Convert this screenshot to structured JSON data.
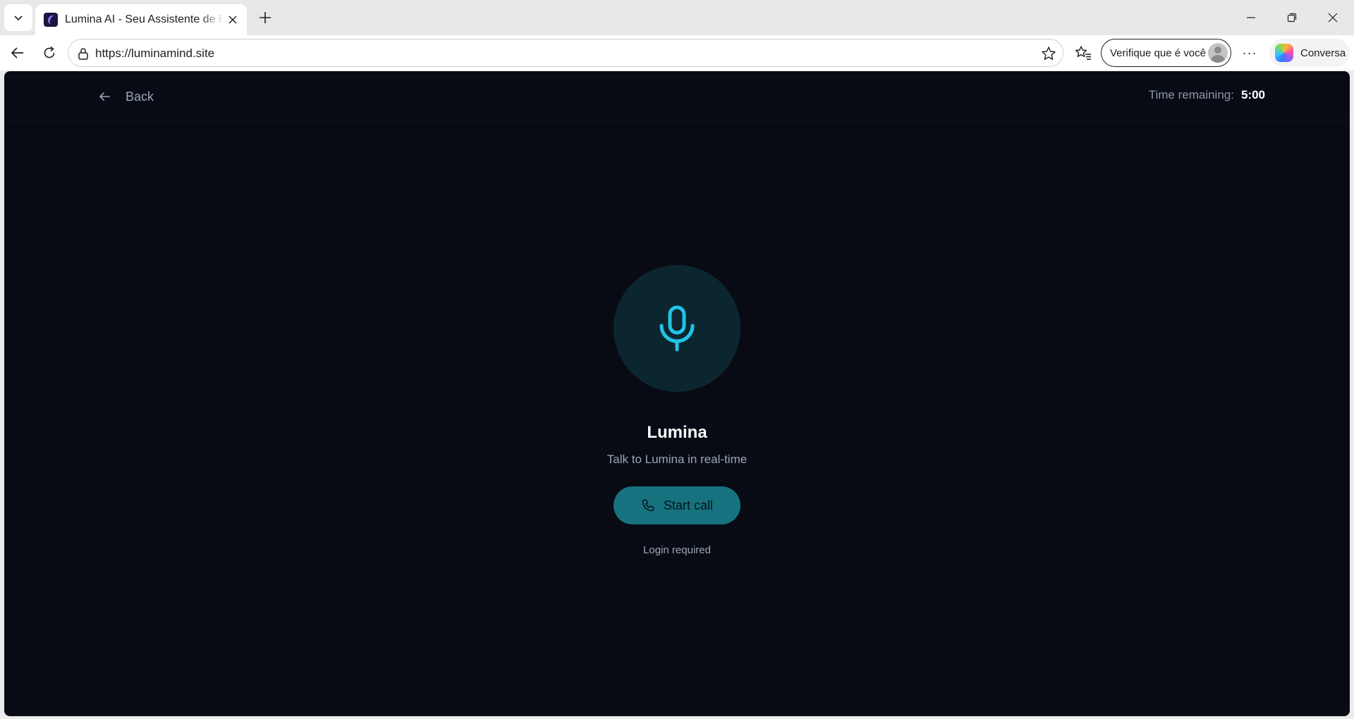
{
  "browser": {
    "tab_title": "Lumina AI - Seu Assistente de Bem-estar",
    "url": "https://luminamind.site",
    "profile_label": "Verifique que é você",
    "copilot_label": "Conversa",
    "more_label": "···"
  },
  "header": {
    "back_label": "Back",
    "timer_label": "Time remaining:",
    "timer_value": "5:00"
  },
  "main": {
    "agent_name": "Lumina",
    "subtitle": "Talk to Lumina in real-time",
    "start_call_label": "Start call",
    "login_note": "Login required"
  },
  "icons": {
    "mic": "mic-icon",
    "phone": "phone-icon",
    "back": "arrow-left-icon"
  },
  "colors": {
    "page_bg": "#080b14",
    "accent": "#22c3e6",
    "button_bg": "#177280",
    "mic_circle_bg": "#0c2630"
  }
}
